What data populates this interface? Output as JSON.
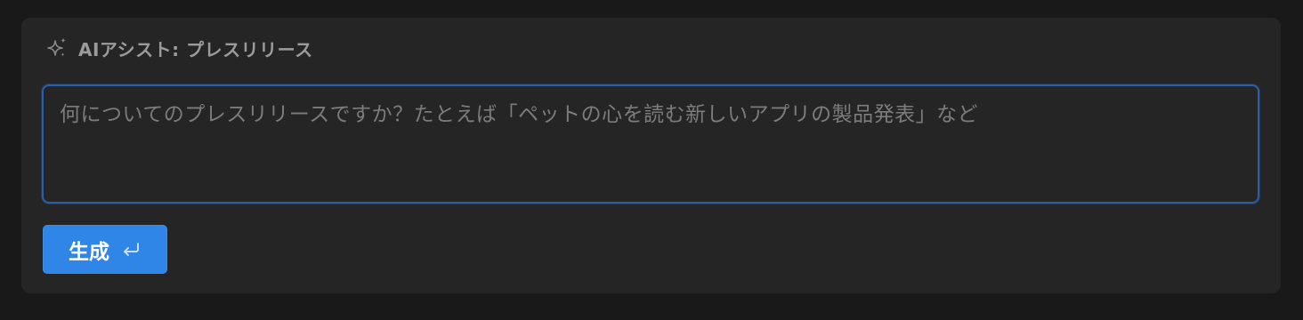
{
  "assist": {
    "title": "AIアシスト: プレスリリース",
    "icon": "sparkle-icon"
  },
  "prompt": {
    "value": "",
    "placeholder": "何についてのプレスリリースですか？たとえば「ペットの心を読む新しいアプリの製品発表」など"
  },
  "generate": {
    "label": "生成",
    "icon": "enter-key-icon"
  },
  "colors": {
    "background": "#191919",
    "panel": "#252525",
    "accent": "#2f86e6",
    "focus_border": "#2a5fa8"
  }
}
